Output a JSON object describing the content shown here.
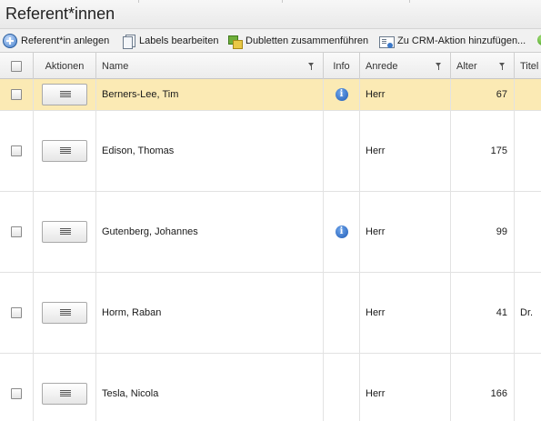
{
  "window": {
    "title": "Referent*innen"
  },
  "toolbar": {
    "add_label": "Referent*in anlegen",
    "labels_label": "Labels bearbeiten",
    "dedup_label": "Dubletten zusammenführen",
    "crm_label": "Zu CRM-Aktion hinzufügen..."
  },
  "table": {
    "columns": {
      "actions": "Aktionen",
      "name": "Name",
      "info": "Info",
      "anrede": "Anrede",
      "alter": "Alter",
      "titel": "Titel"
    },
    "rows": [
      {
        "name": "Berners-Lee, Tim",
        "info": "i",
        "anrede": "Herr",
        "alter": "67",
        "titel": ""
      },
      {
        "name": "Edison, Thomas",
        "info": "",
        "anrede": "Herr",
        "alter": "175",
        "titel": ""
      },
      {
        "name": "Gutenberg, Johannes",
        "info": "i",
        "anrede": "Herr",
        "alter": "99",
        "titel": ""
      },
      {
        "name": "Horm, Raban",
        "info": "",
        "anrede": "Herr",
        "alter": "41",
        "titel": "Dr."
      },
      {
        "name": "Tesla, Nicola",
        "info": "",
        "anrede": "Herr",
        "alter": "166",
        "titel": ""
      }
    ]
  },
  "colors": {
    "selected_row": "#fbeab4",
    "info_icon": "#1f5bb5",
    "accent_green": "#3d9b16"
  }
}
